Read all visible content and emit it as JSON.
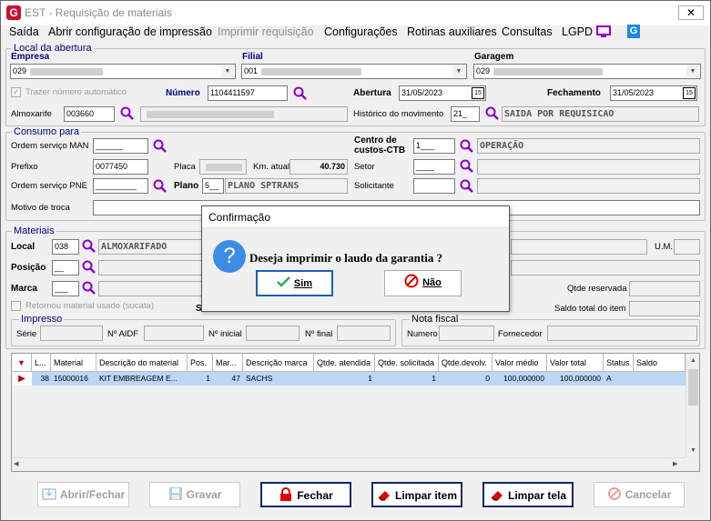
{
  "window": {
    "title": "EST - Requisição de materiais",
    "close": "✕"
  },
  "menu": [
    "Saída",
    "Abrir configuração de impressão",
    "Imprimir requisição",
    "Configurações",
    "Rotinas auxiliares",
    "Consultas",
    "LGPD"
  ],
  "local": {
    "group_title": "Local da abertura",
    "empresa_label": "Empresa",
    "empresa_value": "029",
    "filial_label": "Filial",
    "filial_value": "001",
    "garagem_label": "Garagem",
    "garagem_value": "029",
    "auto_number_label": "Trazer número automático",
    "numero_label": "Número",
    "numero_value": "1104411597",
    "abertura_label": "Abertura",
    "abertura_value": "31/05/2023",
    "fechamento_label": "Fechamento",
    "fechamento_value": "31/05/2023",
    "almoxarife_label": "Almoxarife",
    "almoxarife_value": "003660",
    "historico_label": "Histórico do movimento",
    "historico_value": "21_",
    "historico_desc": "SAIDA POR REQUISICAO",
    "cal_label": "15"
  },
  "consumo": {
    "group_title": "Consumo para",
    "os_man_label": "Ordem serviço MAN",
    "os_man_value": "______",
    "centro_label_1": "Centro de",
    "centro_label_2": "custos-CTB",
    "centro_value": "1___",
    "centro_desc": "OPERAÇÃO",
    "prefixo_label": "Prefixo",
    "prefixo_value": "0077450",
    "placa_label": "Placa",
    "km_label": "Km. atual",
    "km_value": "40.730",
    "setor_label": "Setor",
    "setor_value": "____",
    "os_pne_label": "Ordem serviço PNE",
    "os_pne_value": "_________",
    "plano_label": "Plano",
    "plano_value": "5__",
    "plano_desc": "PLANO SPTRANS",
    "solicitante_label": "Solicitante",
    "motivo_label": "Motivo de troca"
  },
  "materiais": {
    "group_title": "Materiais",
    "local_label": "Local",
    "local_value": "038",
    "local_desc": "ALMOXARIFADO",
    "posicao_label": "Posição",
    "posicao_value": "__",
    "marca_label": "Marca",
    "marca_value": "___",
    "retornou_label": "Retornou material usado (sucata)",
    "um_label": "U.M.",
    "qtde_reservada_label": "Qtde reservada",
    "saldo_total_label": "Saldo total do item",
    "s_label": "S"
  },
  "impresso": {
    "group_title": "Impresso",
    "serie_label": "Série",
    "aidf_label": "Nº AIDF",
    "inicial_label": "Nº inicial",
    "final_label": "Nº final"
  },
  "nota": {
    "group_title": "Nota fiscal",
    "numero_label": "Numero",
    "fornecedor_label": "Fornecedor"
  },
  "grid": {
    "headers": [
      "L...",
      "Material",
      "Descrição do material",
      "Pos.",
      "Mar...",
      "Descrição marca",
      "Qtde. atendida",
      "Qtde. solicitada",
      "Qtde.devolv.",
      "Valor médio",
      "Valor total",
      "Status",
      "Saldo"
    ],
    "row": [
      "38",
      "15000016",
      "KIT EMBREAGEM E...",
      "1",
      "47",
      "SACHS",
      "1",
      "1",
      "0",
      "100,000000",
      "100,000000",
      "A",
      ""
    ]
  },
  "buttons": {
    "abrir": "Abrir/Fechar",
    "gravar": "Gravar",
    "fechar": "Fechar",
    "limpar_item": "Limpar item",
    "limpar_tela": "Limpar tela",
    "cancelar": "Cancelar"
  },
  "dialog": {
    "title": "Confirmação",
    "message": "Deseja imprimir o laudo da garantia ?",
    "yes": "Sim",
    "no": "Não",
    "icon": "?"
  },
  "colors": {
    "accent": "#000080",
    "selected_row": "#bcd6f5",
    "brand": "#c8102e"
  }
}
